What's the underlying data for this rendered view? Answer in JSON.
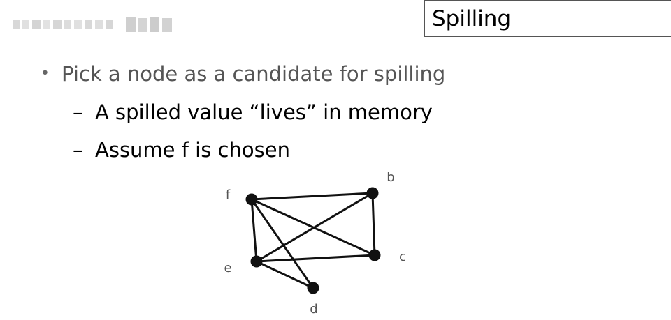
{
  "slide": {
    "title": "Spilling",
    "bullet": {
      "marker": "•",
      "text": "Pick a node as a candidate for spilling"
    },
    "subbullets": [
      {
        "marker": "–",
        "text": "A spilled value “lives” in memory"
      },
      {
        "marker": "–",
        "text": "Assume f is chosen"
      }
    ]
  },
  "graph": {
    "nodes": [
      {
        "id": "f",
        "label": "f"
      },
      {
        "id": "b",
        "label": "b"
      },
      {
        "id": "c",
        "label": "c"
      },
      {
        "id": "e",
        "label": "e"
      },
      {
        "id": "d",
        "label": "d"
      }
    ],
    "edges": [
      [
        "f",
        "b"
      ],
      [
        "f",
        "c"
      ],
      [
        "f",
        "e"
      ],
      [
        "f",
        "d"
      ],
      [
        "b",
        "e"
      ],
      [
        "b",
        "c"
      ],
      [
        "e",
        "c"
      ],
      [
        "e",
        "d"
      ]
    ],
    "colors": {
      "node": "#111111",
      "edge": "#111111",
      "label": "#555555"
    }
  }
}
